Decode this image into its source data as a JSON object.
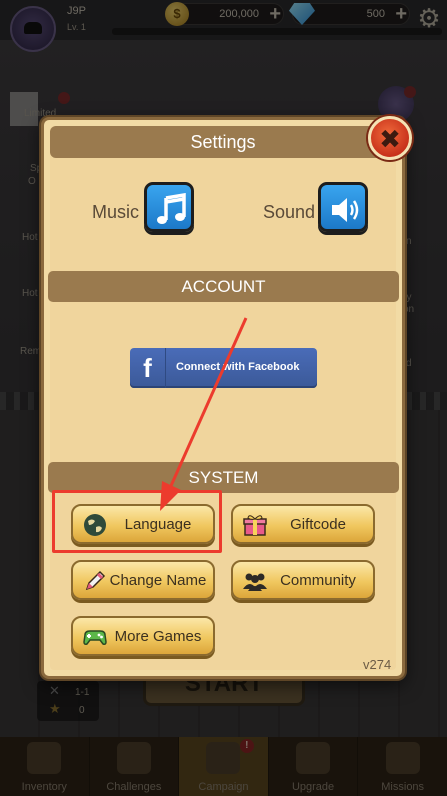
{
  "player": {
    "name": "J9P",
    "level": "Lv. 1"
  },
  "resources": {
    "coins": "200,000",
    "gems": "500"
  },
  "background_side_items": {
    "s1": "Limited",
    "s2": "Sp",
    "s3": "O",
    "s4": "Hot",
    "s5": "Hot",
    "s6": "Rem",
    "s7": "n",
    "s8": "ily",
    "s9": "tion",
    "s10": "d"
  },
  "stage": {
    "level": "1-1",
    "stars": "0",
    "start_label": "START"
  },
  "bottom_nav": {
    "tabs": [
      {
        "label": "Inventory"
      },
      {
        "label": "Challenges"
      },
      {
        "label": "Campaign",
        "badge": "!"
      },
      {
        "label": "Upgrade"
      },
      {
        "label": "Missions"
      }
    ]
  },
  "settings": {
    "title": "Settings",
    "music_label": "Music",
    "sound_label": "Sound",
    "account_header": "ACCOUNT",
    "facebook_button": "Connect with Facebook",
    "facebook_logo": "f",
    "system_header": "SYSTEM",
    "buttons": {
      "language": "Language",
      "giftcode": "Giftcode",
      "change_name": "Change Name",
      "community": "Community",
      "more_games": "More Games"
    },
    "version": "v274",
    "close_symbol": "✖"
  },
  "colors": {
    "accent_red": "#ec3b2d",
    "panel": "#f0d59d",
    "band": "#9a7a4e",
    "icon_blue": "#2a8fdc"
  }
}
